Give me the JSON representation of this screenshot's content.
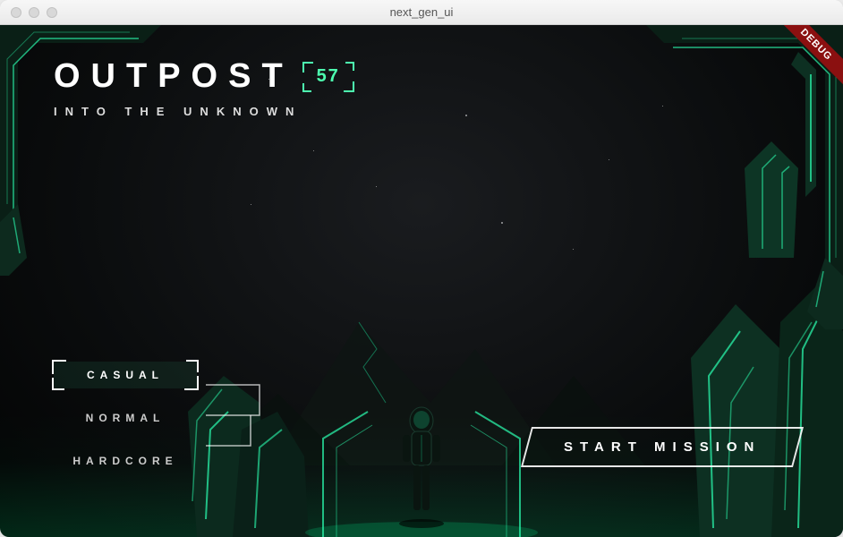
{
  "window": {
    "title": "next_gen_ui"
  },
  "debug_banner": "DEBUG",
  "title": {
    "main": "OUTPOST",
    "badge": "57",
    "subtitle": "INTO THE UNKNOWN"
  },
  "difficulty": {
    "items": [
      {
        "label": "CASUAL",
        "selected": true
      },
      {
        "label": "NORMAL",
        "selected": false
      },
      {
        "label": "HARDCORE",
        "selected": false
      }
    ]
  },
  "start_button": "START MISSION",
  "colors": {
    "accent": "#4dffb0",
    "debug_bg": "#8b1010"
  }
}
